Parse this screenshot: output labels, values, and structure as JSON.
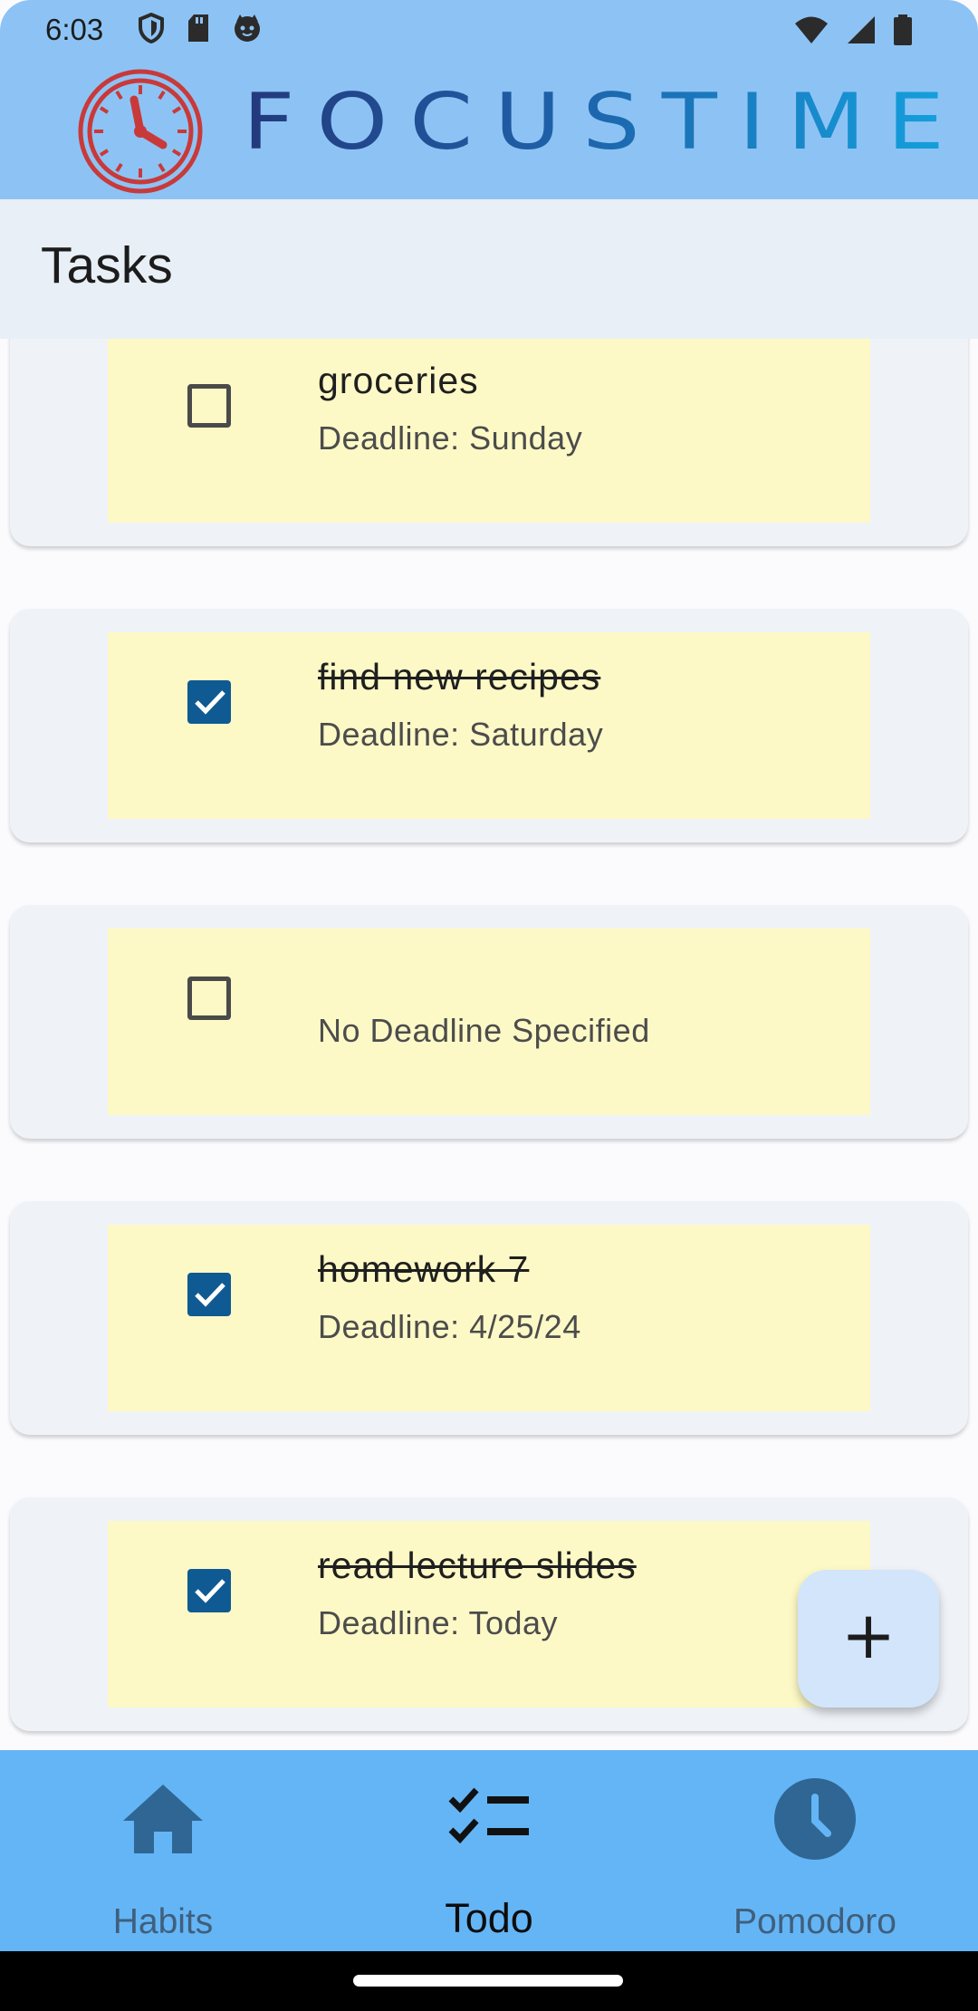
{
  "status_bar": {
    "time": "6:03",
    "left_icons": [
      "shield-icon",
      "sd-card-icon",
      "cat-icon"
    ],
    "right_icons": [
      "wifi-icon",
      "signal-icon",
      "battery-icon"
    ]
  },
  "brand": {
    "name": "FOCUSTIME",
    "logo_icon": "clock-icon",
    "colors": {
      "header_bg": "#8dc3f4",
      "logo_red": "#c83a3a"
    }
  },
  "page": {
    "title": "Tasks"
  },
  "tasks": [
    {
      "title": "groceries",
      "deadline": "Deadline: Sunday",
      "done": false
    },
    {
      "title": "find new recipes",
      "deadline": "Deadline: Saturday",
      "done": true
    },
    {
      "title": "",
      "deadline": "No Deadline Specified",
      "done": false
    },
    {
      "title": "homework 7",
      "deadline": "Deadline: 4/25/24",
      "done": true
    },
    {
      "title": "read lecture slides",
      "deadline": "Deadline: Today",
      "done": true
    }
  ],
  "fab": {
    "label": "+",
    "icon": "plus-icon"
  },
  "bottom_nav": {
    "items": [
      {
        "label": "Habits",
        "icon": "home-icon",
        "active": false
      },
      {
        "label": "Todo",
        "icon": "checklist-icon",
        "active": true
      },
      {
        "label": "Pomodoro",
        "icon": "clock-icon",
        "active": false
      }
    ],
    "colors": {
      "bg": "#64b5f6",
      "active": "#0d0d0d",
      "inactive": "#3f5f7c"
    }
  },
  "colors": {
    "card_bg": "#eff3f8",
    "task_bg": "#fdf9c6",
    "checkbox_checked": "#0f5a93",
    "title_bar_bg": "#e9eff6",
    "fab_bg": "#d2e5fb"
  }
}
